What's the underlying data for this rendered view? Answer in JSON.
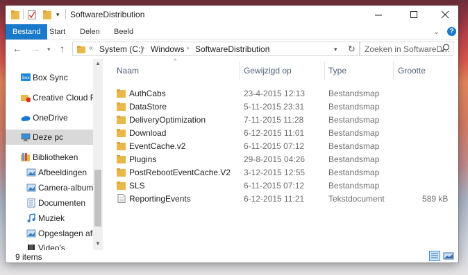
{
  "window": {
    "title": "SoftwareDistribution"
  },
  "ribbon": {
    "tabs": [
      "Bestand",
      "Start",
      "Delen",
      "Beeld"
    ],
    "help": "?"
  },
  "address": {
    "breadcrumbs": [
      "System (C:)",
      "Windows",
      "SoftwareDistribution"
    ],
    "search_placeholder": "Zoeken in SoftwareD..."
  },
  "navpane": {
    "items": [
      {
        "label": "Box Sync",
        "icon": "box-sync-icon"
      },
      {
        "label": "Creative Cloud Files",
        "icon": "creative-cloud-icon"
      },
      {
        "label": "OneDrive",
        "icon": "onedrive-icon"
      },
      {
        "label": "Deze pc",
        "icon": "computer-icon"
      },
      {
        "label": "Bibliotheken",
        "icon": "libraries-icon"
      },
      {
        "label": "Afbeeldingen",
        "icon": "pictures-icon"
      },
      {
        "label": "Camera-album",
        "icon": "camera-roll-icon"
      },
      {
        "label": "Documenten",
        "icon": "documents-icon"
      },
      {
        "label": "Muziek",
        "icon": "music-icon"
      },
      {
        "label": "Opgeslagen afbeeldingen",
        "icon": "saved-pictures-icon"
      },
      {
        "label": "Video's",
        "icon": "videos-icon"
      }
    ]
  },
  "columns": {
    "name": "Naam",
    "date": "Gewijzigd op",
    "type": "Type",
    "size": "Grootte"
  },
  "files": [
    {
      "name": "AuthCabs",
      "date": "23-4-2015 12:13",
      "type": "Bestandsmap",
      "size": ""
    },
    {
      "name": "DataStore",
      "date": "5-11-2015 23:31",
      "type": "Bestandsmap",
      "size": ""
    },
    {
      "name": "DeliveryOptimization",
      "date": "7-11-2015 11:28",
      "type": "Bestandsmap",
      "size": ""
    },
    {
      "name": "Download",
      "date": "6-12-2015 11:01",
      "type": "Bestandsmap",
      "size": ""
    },
    {
      "name": "EventCache.v2",
      "date": "6-11-2015 07:12",
      "type": "Bestandsmap",
      "size": ""
    },
    {
      "name": "Plugins",
      "date": "29-8-2015 04:26",
      "type": "Bestandsmap",
      "size": ""
    },
    {
      "name": "PostRebootEventCache.V2",
      "date": "3-12-2015 12:55",
      "type": "Bestandsmap",
      "size": ""
    },
    {
      "name": "SLS",
      "date": "6-11-2015 07:12",
      "type": "Bestandsmap",
      "size": ""
    },
    {
      "name": "ReportingEvents",
      "date": "6-12-2015 11:21",
      "type": "Tekstdocument",
      "size": "589 kB"
    }
  ],
  "status": {
    "count": "9 items"
  },
  "colors": {
    "accent": "#1979ca",
    "folder": "#e8b84a",
    "selection": "#d9d9d9"
  }
}
